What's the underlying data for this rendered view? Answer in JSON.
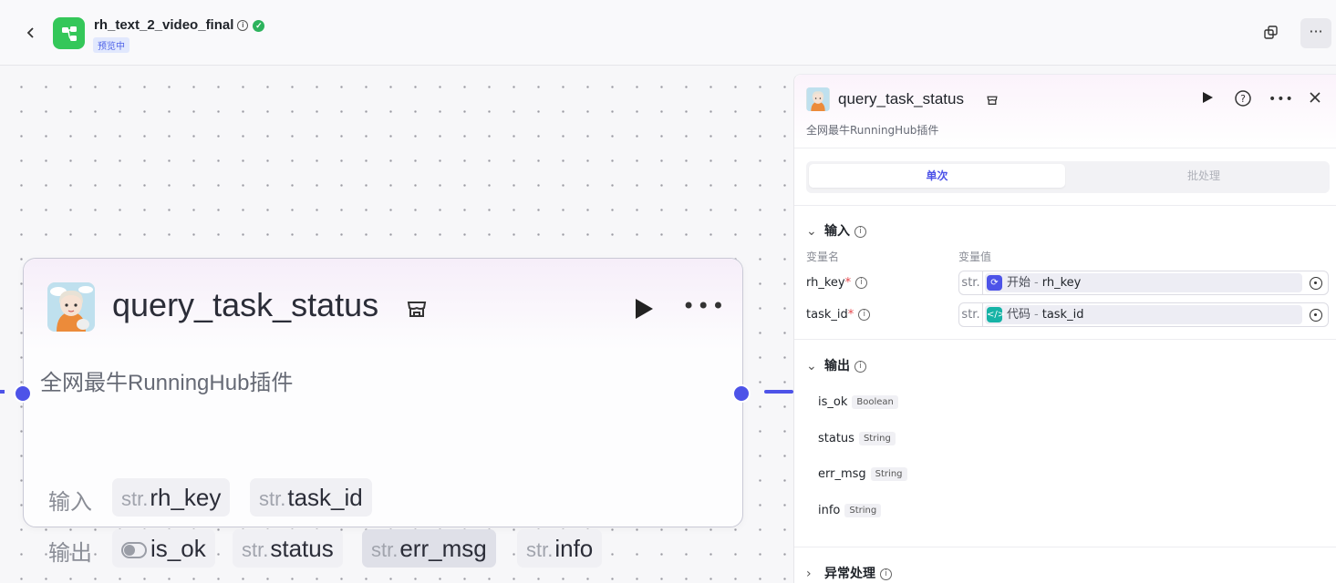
{
  "header": {
    "app_title": "rh_text_2_video_final",
    "status_badge": "预览中"
  },
  "node": {
    "title": "query_task_status",
    "description": "全网最牛RunningHub插件",
    "input_label": "输入",
    "output_label": "输出",
    "inputs": [
      {
        "prefix": "str.",
        "name": "rh_key"
      },
      {
        "prefix": "str.",
        "name": "task_id"
      }
    ],
    "outputs": [
      {
        "prefix": "",
        "name": "is_ok",
        "icon": "toggle-icon"
      },
      {
        "prefix": "str.",
        "name": "status"
      },
      {
        "prefix": "str.",
        "name": "err_msg"
      },
      {
        "prefix": "str.",
        "name": "info"
      }
    ]
  },
  "panel": {
    "title": "query_task_status",
    "description": "全网最牛RunningHub插件",
    "tabs": {
      "single": "单次",
      "batch": "批处理"
    },
    "input_section": {
      "title": "输入",
      "col_name": "变量名",
      "col_value": "变量值",
      "vars": [
        {
          "name": "rh_key",
          "required": "*",
          "prefix": "str.",
          "ref_node": "开始",
          "ref_var": "rh_key",
          "ref_color": "#4d53e8"
        },
        {
          "name": "task_id",
          "required": "*",
          "prefix": "str.",
          "ref_node": "代码",
          "ref_var": "task_id",
          "ref_color": "#16b3a6"
        }
      ]
    },
    "output_section": {
      "title": "输出",
      "items": [
        {
          "name": "is_ok",
          "type": "Boolean"
        },
        {
          "name": "status",
          "type": "String"
        },
        {
          "name": "err_msg",
          "type": "String"
        },
        {
          "name": "info",
          "type": "String"
        }
      ]
    },
    "exception_section": {
      "title": "异常处理"
    }
  },
  "colors": {
    "accent": "#4d53e8",
    "success": "#2db35d",
    "app_icon": "#34c759"
  }
}
